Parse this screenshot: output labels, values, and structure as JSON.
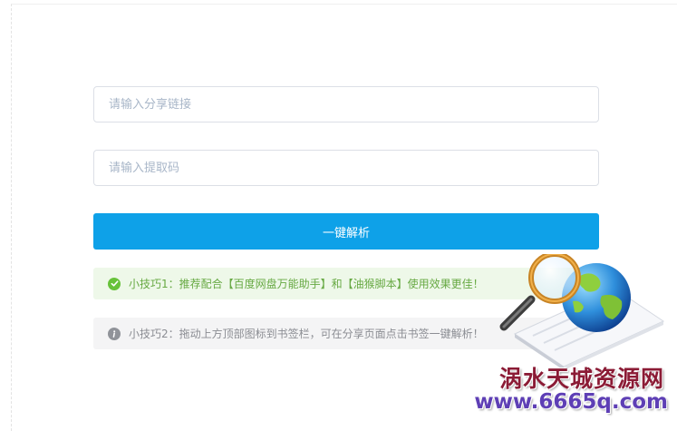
{
  "form": {
    "share_link_placeholder": "请输入分享链接",
    "share_link_value": "",
    "extract_code_placeholder": "请输入提取码",
    "extract_code_value": "",
    "parse_button_label": "一键解析"
  },
  "tips": [
    {
      "type": "success",
      "icon": "check-circle-icon",
      "text": "小技巧1：推荐配合【百度网盘万能助手】和【油猴脚本】使用效果更佳！"
    },
    {
      "type": "info",
      "icon": "info-circle-icon",
      "text": "小技巧2：拖动上方顶部图标到书签栏，可在分享页面点击书签一键解析！"
    }
  ],
  "watermark": {
    "name": "涡水天城资源网",
    "url": "www.6665q.com",
    "icon": "globe-magnifier-icon"
  },
  "colors": {
    "primary": "#0ea1e8",
    "success_bg": "#eef8e9",
    "success_text": "#67a943",
    "info_bg": "#f4f4f5",
    "info_text": "#8b8d93",
    "watermark_name": "#8b1b35",
    "watermark_url": "#5e3fb5"
  }
}
